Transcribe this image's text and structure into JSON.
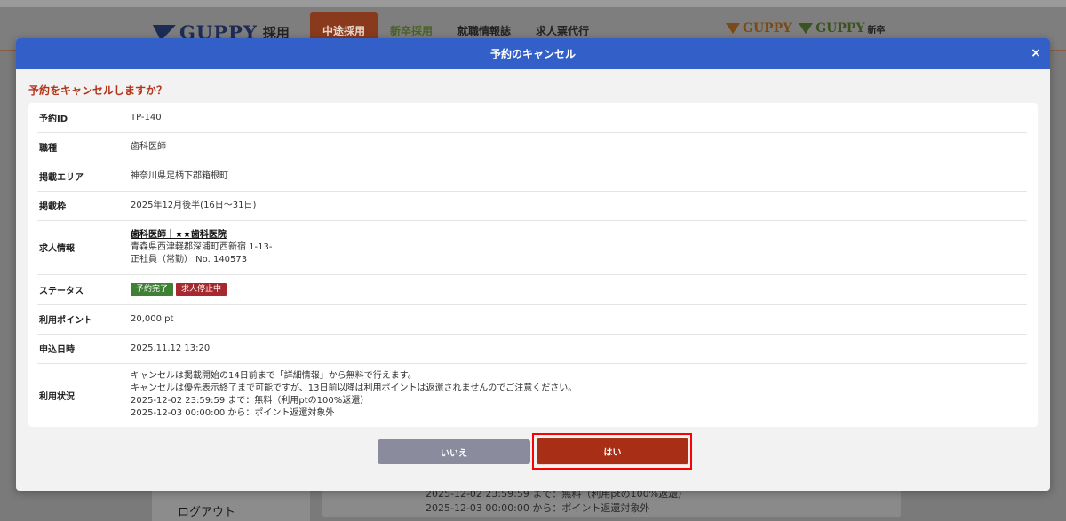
{
  "background": {
    "logo": {
      "brand": "GUPPY",
      "sub": "採用"
    },
    "nav": [
      {
        "label": "中途採用",
        "active": true
      },
      {
        "label": "新卒採用",
        "active": false
      },
      {
        "label": "就職情報誌",
        "active": false
      },
      {
        "label": "求人票代行",
        "active": false
      }
    ],
    "brand_links": [
      {
        "brand": "GUPPY",
        "sub": ""
      },
      {
        "brand": "GUPPY",
        "sub": "新卒"
      }
    ],
    "sidebar_logout": "ログアウト",
    "content_lines": [
      "2025-12-02 23:59:59 まで：無料（利用ptの100%返還）",
      "2025-12-03 00:00:00 から：ポイント返還対象外"
    ]
  },
  "modal": {
    "title": "予約のキャンセル",
    "close": "×",
    "question": "予約をキャンセルしますか？",
    "rows": {
      "reservation_id": {
        "label": "予約ID",
        "value": "TP-140"
      },
      "job_type": {
        "label": "職種",
        "value": "歯科医師"
      },
      "area": {
        "label": "掲載エリア",
        "value": "神奈川県足柄下郡箱根町"
      },
      "slot": {
        "label": "掲載枠",
        "value": "2025年12月後半(16日〜31日)"
      },
      "job_info": {
        "label": "求人情報",
        "title": "歯科医師｜★★歯科医院",
        "address": "青森県西津軽郡深浦町西新宿 1-13-",
        "employment": "正社員（常勤） No. 140573"
      },
      "status": {
        "label": "ステータス",
        "badges": [
          "予約完了",
          "求人停止中"
        ]
      },
      "points": {
        "label": "利用ポイント",
        "value": "20,000 pt"
      },
      "applied_at": {
        "label": "申込日時",
        "value": "2025.11.12 13:20"
      },
      "usage": {
        "label": "利用状況",
        "lines": [
          "キャンセルは掲載開始の14日前まで「詳細情報」から無料で行えます。",
          "キャンセルは優先表示終了まで可能ですが、13日前以降は利用ポイントは返還されませんのでご注意ください。",
          "2025-12-02 23:59:59 まで：無料（利用ptの100%返還）",
          "2025-12-03 00:00:00 から：ポイント返還対象外"
        ]
      }
    },
    "buttons": {
      "no": "いいえ",
      "yes": "はい"
    }
  }
}
